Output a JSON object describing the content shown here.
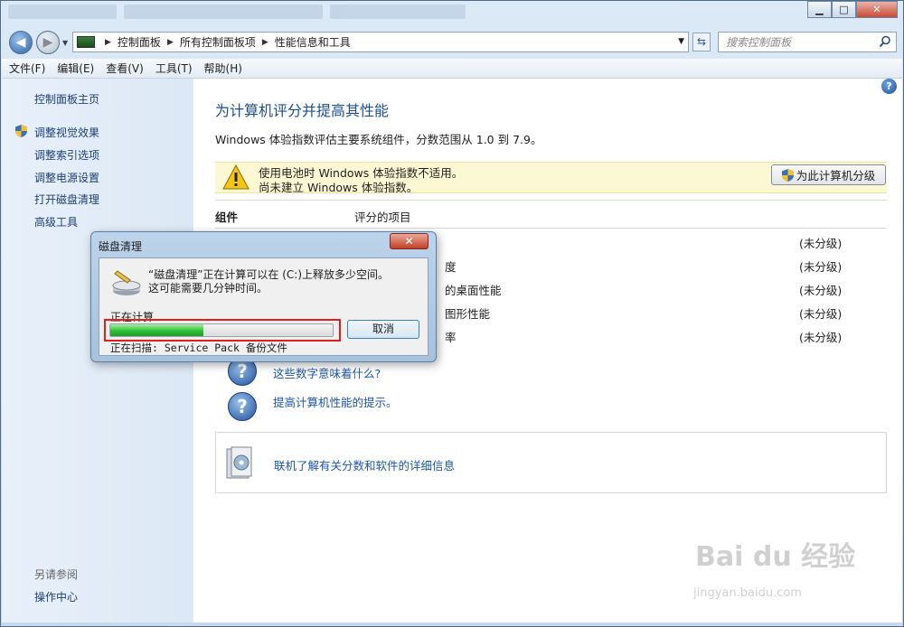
{
  "window": {
    "caption_min": "▁",
    "caption_max": "□",
    "caption_close": "✕"
  },
  "address": {
    "crumbs": [
      "控制面板",
      "所有控制面板项",
      "性能信息和工具"
    ],
    "search_placeholder": "搜索控制面板"
  },
  "menu": [
    "文件(F)",
    "编辑(E)",
    "查看(V)",
    "工具(T)",
    "帮助(H)"
  ],
  "sidebar": {
    "home": "控制面板主页",
    "items": [
      "调整视觉效果",
      "调整索引选项",
      "调整电源设置",
      "打开磁盘清理",
      "高级工具"
    ],
    "see_also": "另请参阅",
    "action_center": "操作中心"
  },
  "main": {
    "title": "为计算机评分并提高其性能",
    "description": "Windows 体验指数评估主要系统组件，分数范围从 1.0 到 7.9。",
    "warning_line1": "使用电池时 Windows 体验指数不适用。",
    "warning_line2": "尚未建立 Windows 体验指数。",
    "rate_button": "为此计算机分级",
    "col_component": "组件",
    "col_items": "评分的项目",
    "rows": [
      {
        "item": "",
        "score": "(未分级)"
      },
      {
        "item": "度",
        "score": "(未分级)"
      },
      {
        "item": "的桌面性能",
        "score": "(未分级)"
      },
      {
        "item": "图形性能",
        "score": "(未分级)"
      },
      {
        "item": "率",
        "score": "(未分级)"
      }
    ],
    "link_meaning": "这些数字意味着什么?",
    "link_tips": "提高计算机性能的提示。",
    "info_link": "联机了解有关分数和软件的详细信息"
  },
  "dialog": {
    "title": "磁盘清理",
    "close": "✕",
    "message_line1": "“磁盘清理”正在计算可以在 (C:)上释放多少空间。",
    "message_line2": "这可能需要几分钟时间。",
    "calculating": "正在计算...",
    "progress": 0.42,
    "cancel": "取消",
    "scanning": "正在扫描:  Service Pack 备份文件"
  },
  "watermark": {
    "brand": "Bai du 经验",
    "url": "jingyan.baidu.com"
  },
  "colors": {
    "link": "#1c56a8",
    "title": "#1e4e8c",
    "progress": "#2fbf3a",
    "highlight": "#e02020"
  }
}
